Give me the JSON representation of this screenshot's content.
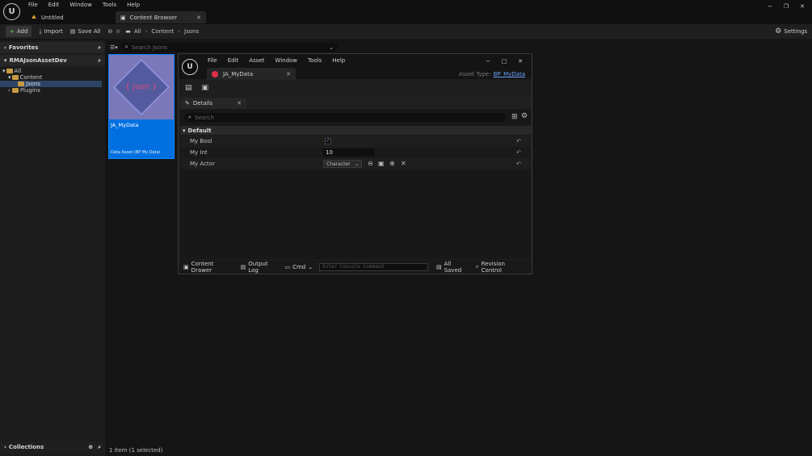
{
  "titlebar": {
    "menu": [
      "File",
      "Edit",
      "Window",
      "Tools",
      "Help"
    ],
    "tabs": [
      {
        "label": "Untitled"
      },
      {
        "label": "Content Browser"
      }
    ],
    "window_controls": [
      "−",
      "❐",
      "✕"
    ]
  },
  "toolbar": {
    "add": "Add",
    "import": "Import",
    "save_all": "Save All",
    "breadcrumb": [
      "All",
      "Content",
      "Jsons"
    ],
    "settings": "Settings"
  },
  "sidebar": {
    "favorites": "Favorites",
    "project": "RMAJsonAssetDev",
    "tree": [
      {
        "label": "All",
        "depth": 0
      },
      {
        "label": "Content",
        "depth": 1
      },
      {
        "label": "Jsons",
        "depth": 2,
        "selected": true
      },
      {
        "label": "Plugins",
        "depth": 1
      }
    ],
    "collections": "Collections"
  },
  "content": {
    "search_placeholder": "Search Jsons",
    "asset": {
      "thumb_text": "{ json }",
      "name": "JA_MyData",
      "type": "Data Asset (BP My Data)"
    },
    "status": "1 item (1 selected)"
  },
  "editor": {
    "menu": [
      "File",
      "Edit",
      "Asset",
      "Window",
      "Tools",
      "Help"
    ],
    "tab": "JA_MyData",
    "asset_type_label": "Asset Type:",
    "asset_type_value": "BP_MyData",
    "window_controls": [
      "−",
      "□",
      "✕"
    ],
    "details": {
      "tab": "Details",
      "search_placeholder": "Search",
      "category": "Default",
      "props": {
        "bool": {
          "label": "My Bool",
          "checked": true
        },
        "int": {
          "label": "My Int",
          "value": "10"
        },
        "actor": {
          "label": "My Actor",
          "value": "Character"
        }
      }
    },
    "statusbar": {
      "drawer": "Content Drawer",
      "output": "Output Log",
      "cmd": "Cmd",
      "console_placeholder": "Enter Console Command",
      "saved": "All Saved",
      "revision": "Revision Control"
    }
  },
  "colors": {
    "accent": "#0070e0",
    "selection": "#1e3f66",
    "thumb_bg": "#7070b0",
    "thumb_text": "#d94c7c",
    "link": "#6aa0ff"
  }
}
